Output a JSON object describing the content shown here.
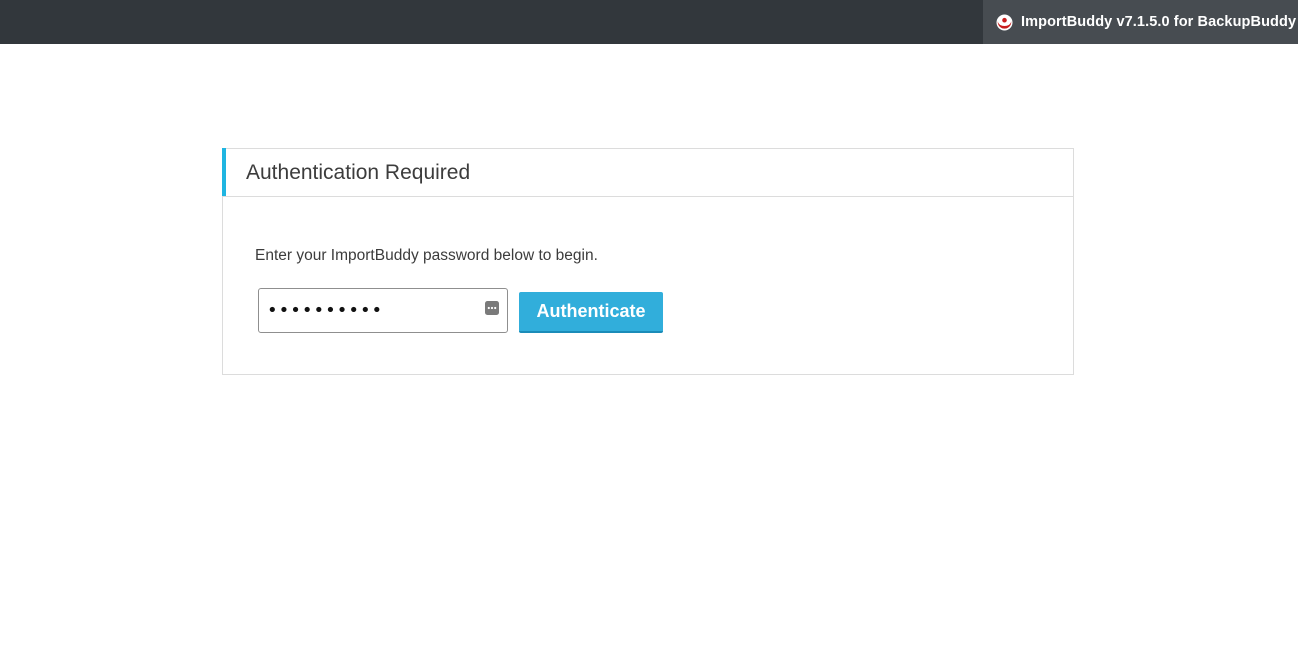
{
  "topbar": {
    "brand_icon": "importbuddy-logo-icon",
    "brand_text": "ImportBuddy v7.1.5.0 for BackupBuddy"
  },
  "auth_panel": {
    "title": "Authentication Required",
    "instructions": "Enter your ImportBuddy password below to begin.",
    "password": {
      "value": "••••••••••",
      "keychain_icon": "password-autofill-icon"
    },
    "authenticate_label": "Authenticate"
  },
  "colors": {
    "topbar_bg": "#32373c",
    "brand_bg": "#474c51",
    "accent": "#1fb5e1",
    "button_bg": "#31aedb"
  }
}
